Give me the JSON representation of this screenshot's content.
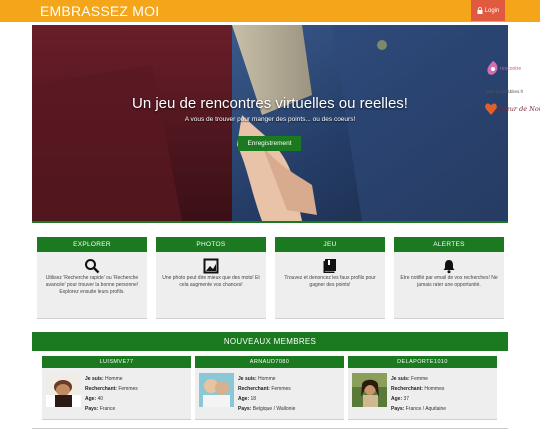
{
  "header": {
    "brand": "EMBRASSEZ MOI",
    "login_label": "Login",
    "brand_color": "#f5a519",
    "login_color": "#e05a3f"
  },
  "hero": {
    "title": "Un jeu de rencontres virtuelles ou reelles!",
    "subtitle": "A vous de trouver pour manger des points... ou des coeurs!",
    "cta_label": "Enregistrement"
  },
  "side_ads": {
    "ad1_text": "rencontre",
    "ad_url": "www.singlesbites.fr",
    "ad2_text": "Coeur de Nous"
  },
  "features": [
    {
      "title": "EXPLORER",
      "icon": "search-icon",
      "text": "Utilisez 'Recherche rapide' ou 'Recherche avancée' pour trouver la bonne personne! Explorez ensuite leurs profils."
    },
    {
      "title": "PHOTOS",
      "icon": "photo-icon",
      "text": "Une photo peut dire mieux que des mots! Et cela augmente vos chances!"
    },
    {
      "title": "JEU",
      "icon": "book-icon",
      "text": "Trouvez et denoncez les faux profils pour gagner des points!"
    },
    {
      "title": "ALERTES",
      "icon": "bell-icon",
      "text": "Etre notifié par email de vos recherches! Ne jamais rater une opportunité."
    }
  ],
  "members_section": {
    "title": "NOUVEAUX MEMBRES",
    "labels": {
      "je_suis": "Je suis:",
      "recherchant": "Recherchant:",
      "age": "Age:",
      "pays": "Pays:"
    },
    "members": [
      {
        "username": "LUISMVE77",
        "je_suis": "Homme",
        "recherchant": "Femmes",
        "age": "40",
        "pays": "France"
      },
      {
        "username": "ARNAUD7080",
        "je_suis": "Homme",
        "recherchant": "Femmes",
        "age": "18",
        "pays": "Belgique / Wallonie"
      },
      {
        "username": "DELAPORTE1010",
        "je_suis": "Femme",
        "recherchant": "Hommes",
        "age": "37",
        "pays": "France / Aquitaine"
      }
    ]
  },
  "accent_color": "#1b7a20"
}
